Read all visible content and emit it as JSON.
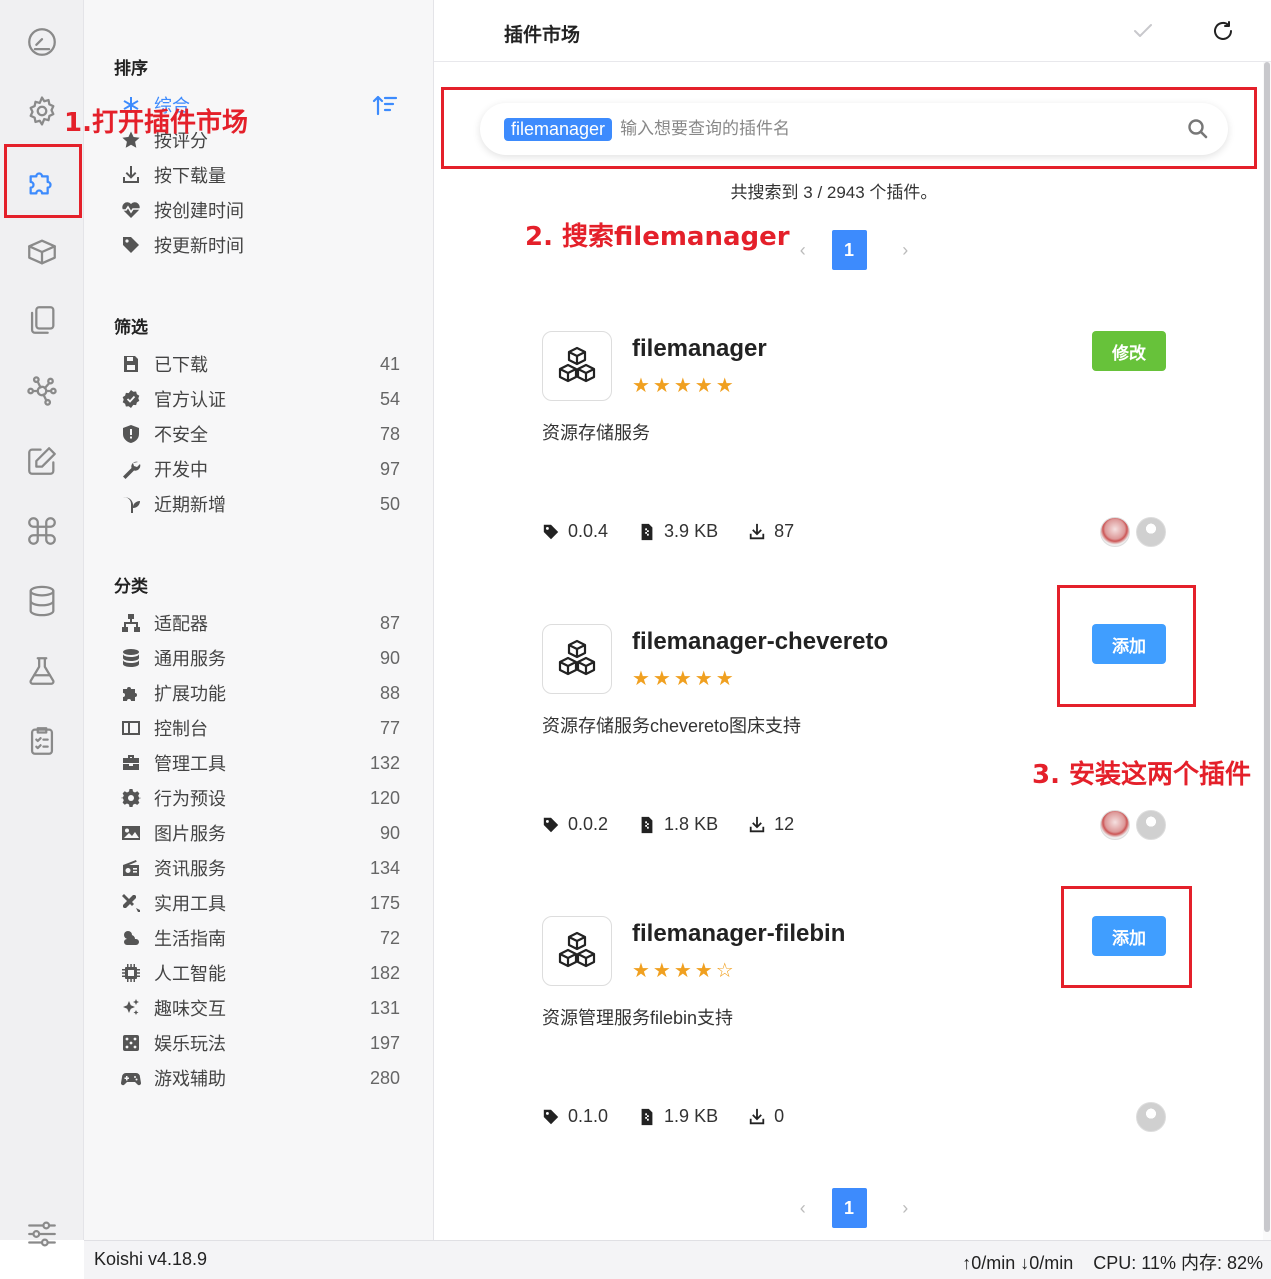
{
  "app": {
    "version": "Koishi v4.18.9"
  },
  "status": {
    "upload": "0/min",
    "download": "0/min",
    "cpu": "CPU: 11% 内存: 82%"
  },
  "sidebar": {
    "sort_title": "排序",
    "sort_items": [
      {
        "label": "综合",
        "icon": "asterisk-icon"
      },
      {
        "label": "按评分",
        "icon": "star-icon"
      },
      {
        "label": "按下载量",
        "icon": "download-icon"
      },
      {
        "label": "按创建时间",
        "icon": "heartbeat-icon"
      },
      {
        "label": "按更新时间",
        "icon": "tag-icon"
      }
    ],
    "filter_title": "筛选",
    "filter_items": [
      {
        "label": "已下载",
        "count": "41",
        "icon": "save-icon"
      },
      {
        "label": "官方认证",
        "count": "54",
        "icon": "verified-icon"
      },
      {
        "label": "不安全",
        "count": "78",
        "icon": "shield-icon"
      },
      {
        "label": "开发中",
        "count": "97",
        "icon": "wrench-icon"
      },
      {
        "label": "近期新增",
        "count": "50",
        "icon": "seedling-icon"
      }
    ],
    "category_title": "分类",
    "category_items": [
      {
        "label": "适配器",
        "count": "87",
        "icon": "sitemap-icon"
      },
      {
        "label": "通用服务",
        "count": "90",
        "icon": "database-icon"
      },
      {
        "label": "扩展功能",
        "count": "88",
        "icon": "puzzle-icon"
      },
      {
        "label": "控制台",
        "count": "77",
        "icon": "window-icon"
      },
      {
        "label": "管理工具",
        "count": "132",
        "icon": "toolbox-icon"
      },
      {
        "label": "行为预设",
        "count": "120",
        "icon": "cog-icon"
      },
      {
        "label": "图片服务",
        "count": "90",
        "icon": "image-icon"
      },
      {
        "label": "资讯服务",
        "count": "134",
        "icon": "radio-icon"
      },
      {
        "label": "实用工具",
        "count": "175",
        "icon": "tools-icon"
      },
      {
        "label": "生活指南",
        "count": "72",
        "icon": "weather-icon"
      },
      {
        "label": "人工智能",
        "count": "182",
        "icon": "chip-icon"
      },
      {
        "label": "趣味交互",
        "count": "131",
        "icon": "sparkles-icon"
      },
      {
        "label": "娱乐玩法",
        "count": "197",
        "icon": "dice-icon"
      },
      {
        "label": "游戏辅助",
        "count": "280",
        "icon": "gamepad-icon"
      }
    ]
  },
  "main": {
    "title": "插件市场",
    "search": {
      "tag": "filemanager",
      "placeholder": "输入想要查询的插件名"
    },
    "result_count": "共搜索到 3 / 2943 个插件。",
    "page": "1",
    "plugins": [
      {
        "name": "filemanager",
        "stars": "★★★★★",
        "rating": 5,
        "desc": "资源存储服务",
        "version": "0.0.4",
        "size": "3.9 KB",
        "downloads": "87",
        "action": "修改",
        "action_color": "#67c23a"
      },
      {
        "name": "filemanager-chevereto",
        "stars": "★★★★★",
        "rating": 5,
        "desc": "资源存储服务chevereto图床支持",
        "version": "0.0.2",
        "size": "1.8 KB",
        "downloads": "12",
        "action": "添加",
        "action_color": "#409eff"
      },
      {
        "name": "filemanager-filebin",
        "stars": "★★★★☆",
        "rating": 4,
        "desc": "资源管理服务filebin支持",
        "version": "0.1.0",
        "size": "1.9 KB",
        "downloads": "0",
        "action": "添加",
        "action_color": "#409eff"
      }
    ]
  },
  "annotations": {
    "step1": "1.打开插件市场",
    "step2": "2. 搜索filemanager",
    "step3": "3. 安装这两个插件"
  },
  "colors": {
    "accent": "#3d8bfd",
    "annotation": "#e4202a",
    "star": "#f0a020"
  }
}
